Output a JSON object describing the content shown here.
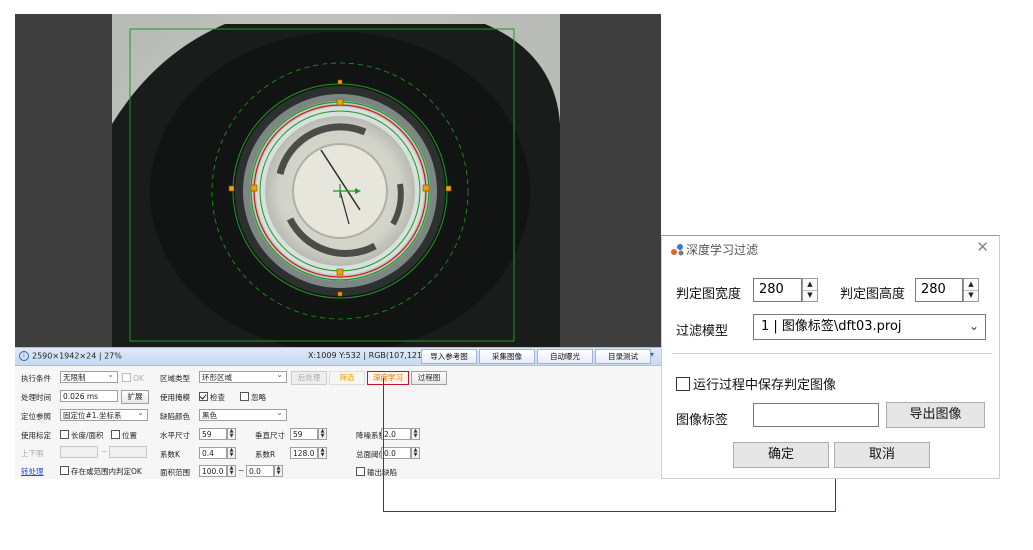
{
  "status_bar": {
    "image_info": "2590×1942×24 | 27%",
    "pixel_info": "X:1009 Y:532 | RGB(107,121,121)",
    "buttons": [
      "导入参考图",
      "采集图像",
      "自动曝光",
      "目录测试"
    ]
  },
  "settings": {
    "exec_condition_label": "执行条件",
    "exec_condition_value": "无限制",
    "ok_label": "OK",
    "process_time_label": "处理时间",
    "process_time_value": "0.026 ms",
    "expand_button": "扩展",
    "position_ref_label": "定位参照",
    "position_ref_value": "固定位#1.坐标系",
    "use_calib_label": "使用标定",
    "length_area_label": "长度/面积",
    "position_label": "位置",
    "upper_lower_label": "上下限",
    "tilde": "~",
    "post_process_link": "转处理",
    "in_range_ok_label": "存在或范围内判定OK",
    "region_type_label": "区域类型",
    "region_type_value": "环形区域",
    "use_mask_label": "使用掩模",
    "check_label": "检查",
    "ignore_label": "忽略",
    "defect_color_label": "缺陷颜色",
    "defect_color_value": "黑色",
    "h_size_label": "水平尺寸",
    "h_size_value": "59",
    "v_size_label": "垂直尺寸",
    "v_size_value": "59",
    "noise_label": "降噪系数",
    "noise_value": "2.0",
    "coef_k_label": "系数K",
    "coef_k_value": "0.4",
    "coef_r_label": "系数R",
    "coef_r_value": "128.0",
    "total_threshold_label": "总面阈值",
    "total_threshold_value": "0.0",
    "area_range_label": "面积范围",
    "area_min_value": "100.0",
    "area_max_value": "0.0",
    "output_defect_label": "输出缺陷",
    "tool_buttons": [
      "后处理",
      "筛选",
      "深度学习",
      "过程图"
    ]
  },
  "dialog": {
    "title": "深度学习过滤",
    "close_icon": "✕",
    "width_label": "判定图宽度",
    "width_value": "280",
    "height_label": "判定图高度",
    "height_value": "280",
    "model_label": "过滤模型",
    "model_value": "1 | 图像标签\\dft03.proj",
    "save_check_label": "运行过程中保存判定图像",
    "image_tag_label": "图像标签",
    "image_tag_value": "",
    "export_button": "导出图像",
    "ok_button": "确定",
    "cancel_button": "取消"
  },
  "colors": {
    "annotation_line": "#a0142a",
    "highlight_button_border": "#c8102e",
    "roi_green": "#1f9a1f",
    "roi_red": "#d01818",
    "handle_orange": "#f0a000"
  }
}
